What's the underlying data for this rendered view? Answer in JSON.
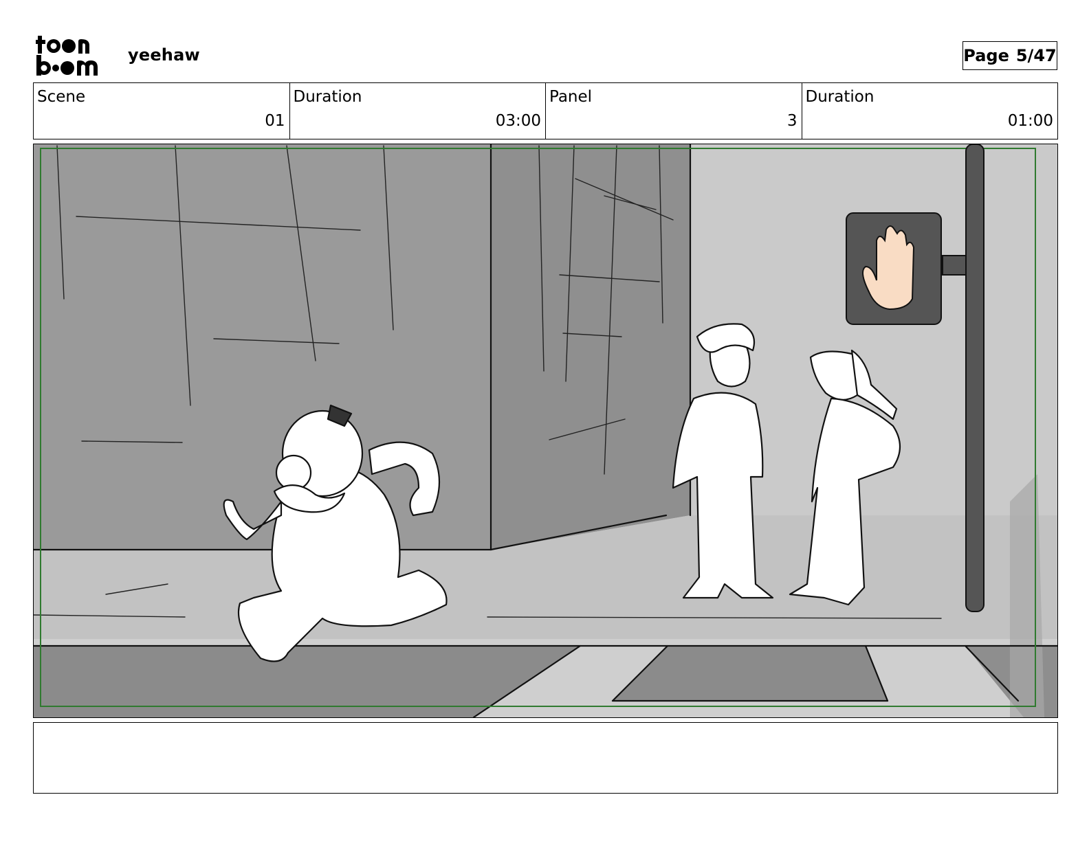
{
  "header": {
    "logo_text": "toon boom",
    "project_title": "yeehaw",
    "page_label": "Page",
    "page_value": "5/47"
  },
  "info": {
    "scene": {
      "label": "Scene",
      "value": "01"
    },
    "scene_duration": {
      "label": "Duration",
      "value": "03:00"
    },
    "panel": {
      "label": "Panel",
      "value": "3"
    },
    "panel_duration": {
      "label": "Duration",
      "value": "01:00"
    }
  },
  "notes": {
    "text": ""
  },
  "colors": {
    "safe_frame": "#2f7a2f",
    "wall_dark": "#9a9a9a",
    "wall_mid": "#8c8c8c",
    "ground": "#c3c3c3",
    "sign_box": "#555555",
    "hand_skin": "#f9dcc4"
  }
}
